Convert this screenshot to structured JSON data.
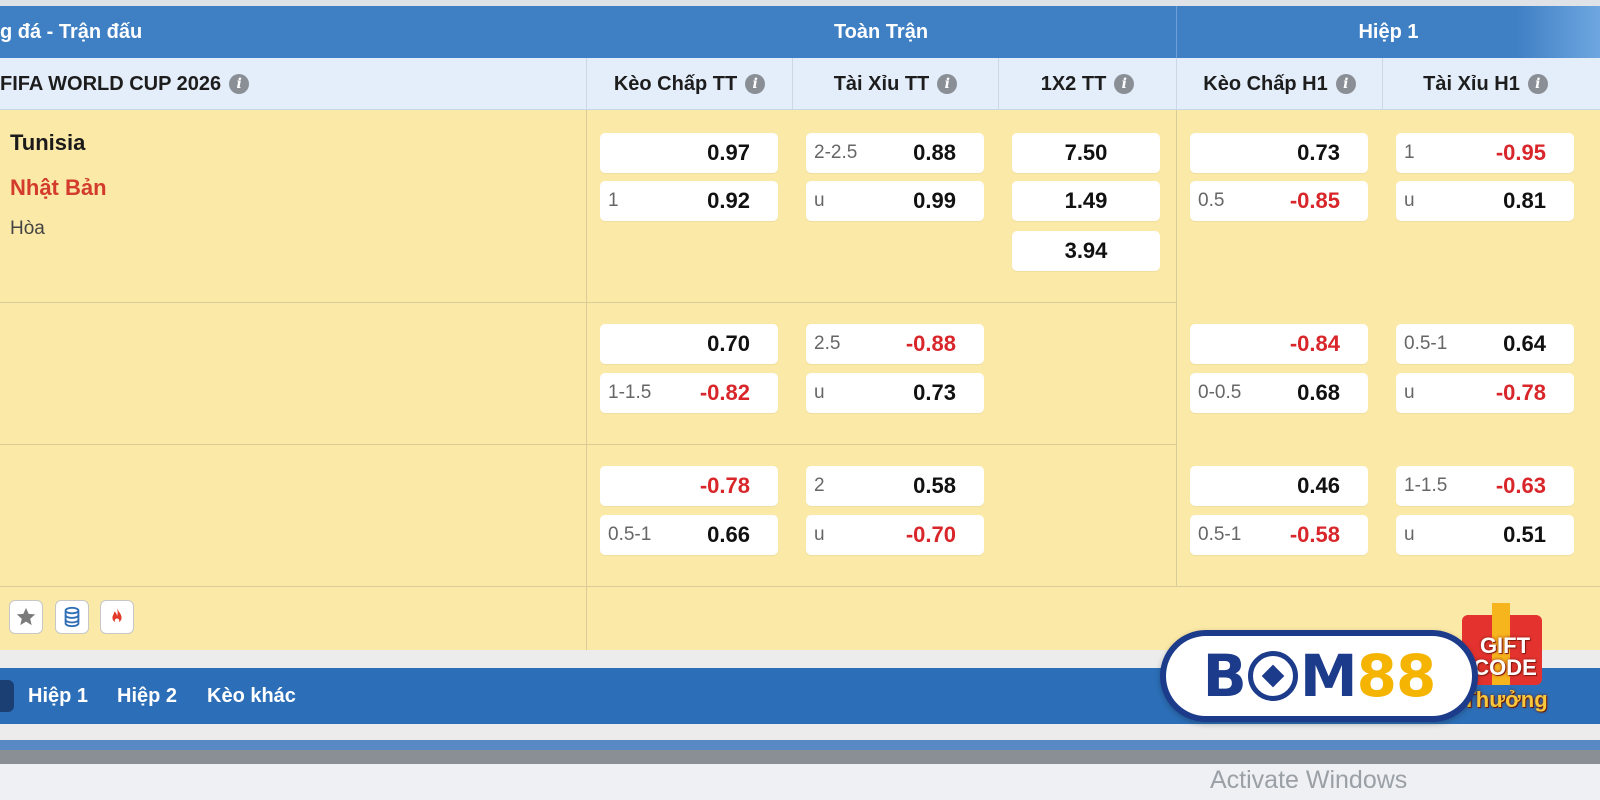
{
  "header": {
    "sport_title": "g đá - Trận đấu",
    "full_match_title": "Toàn Trận",
    "first_half_title": "Hiệp 1"
  },
  "columns": {
    "league": "FIFA WORLD CUP 2026",
    "handicap_ft": "Kèo Chấp TT",
    "over_under_ft": "Tài Xỉu TT",
    "one_x_two_ft": "1X2 TT",
    "handicap_h1": "Kèo Chấp H1",
    "over_under_h1": "Tài Xỉu H1"
  },
  "match": {
    "home": "Tunisia",
    "away": "Nhật Bản",
    "draw": "Hòa"
  },
  "rows": [
    {
      "hdp_ft": [
        {
          "line": "",
          "price": "0.97"
        },
        {
          "line": "1",
          "price": "0.92"
        }
      ],
      "ou_ft": [
        {
          "line": "2-2.5",
          "price": "0.88"
        },
        {
          "line": "u",
          "price": "0.99"
        }
      ],
      "x12_ft": [
        "7.50",
        "1.49",
        "3.94"
      ],
      "hdp_h1": [
        {
          "line": "",
          "price": "0.73"
        },
        {
          "line": "0.5",
          "price": "-0.85"
        }
      ],
      "ou_h1": [
        {
          "line": "1",
          "price": "-0.95"
        },
        {
          "line": "u",
          "price": "0.81"
        }
      ]
    },
    {
      "hdp_ft": [
        {
          "line": "",
          "price": "0.70"
        },
        {
          "line": "1-1.5",
          "price": "-0.82"
        }
      ],
      "ou_ft": [
        {
          "line": "2.5",
          "price": "-0.88"
        },
        {
          "line": "u",
          "price": "0.73"
        }
      ],
      "hdp_h1": [
        {
          "line": "",
          "price": "-0.84"
        },
        {
          "line": "0-0.5",
          "price": "0.68"
        }
      ],
      "ou_h1": [
        {
          "line": "0.5-1",
          "price": "0.64"
        },
        {
          "line": "u",
          "price": "-0.78"
        }
      ]
    },
    {
      "hdp_ft": [
        {
          "line": "",
          "price": "-0.78"
        },
        {
          "line": "0.5-1",
          "price": "0.66"
        }
      ],
      "ou_ft": [
        {
          "line": "2",
          "price": "0.58"
        },
        {
          "line": "u",
          "price": "-0.70"
        }
      ],
      "hdp_h1": [
        {
          "line": "",
          "price": "0.46"
        },
        {
          "line": "0.5-1",
          "price": "-0.58"
        }
      ],
      "ou_h1": [
        {
          "line": "1-1.5",
          "price": "-0.63"
        },
        {
          "line": "u",
          "price": "0.51"
        }
      ]
    }
  ],
  "action_icons": [
    "star-icon",
    "database-icon",
    "fire-icon"
  ],
  "bottom_nav": {
    "tabs": [
      "Hiệp 1",
      "Hiệp 2",
      "Kèo khác"
    ]
  },
  "logo": {
    "left": "B",
    "middle": "M",
    "right": "88",
    "gift_line1": "GIFT",
    "gift_line2": "CODE",
    "gift_line3": "Thưởng"
  },
  "os_watermark": "Activate Windows",
  "colors": {
    "header_blue": "#3f7fc4",
    "body_yellow": "#fbe9a7",
    "negative_red": "#d8262a",
    "away_team_red": "#d33b2c",
    "logo_navy": "#1c3b8a",
    "logo_gold": "#f4b400"
  }
}
